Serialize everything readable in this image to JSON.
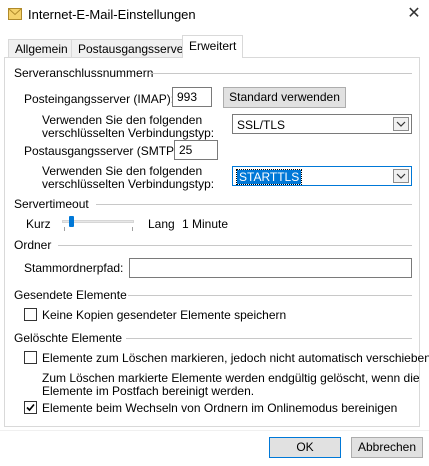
{
  "window": {
    "title": "Internet-E-Mail-Einstellungen",
    "close_glyph": "✕"
  },
  "tabs": [
    {
      "label": "Allgemein",
      "active": false
    },
    {
      "label": "Postausgangsserver",
      "active": false
    },
    {
      "label": "Erweitert",
      "active": true
    }
  ],
  "server_ports": {
    "heading": "Serveranschlussnummern",
    "incoming_label": "Posteingangsserver (IMAP):",
    "incoming_value": "993",
    "default_button": "Standard verwenden",
    "enc_in_label_1": "Verwenden Sie den folgenden",
    "enc_in_label_2": "verschlüsselten Verbindungstyp:",
    "enc_in_value": "SSL/TLS",
    "outgoing_label": "Postausgangsserver (SMTP):",
    "outgoing_value": "25",
    "enc_out_label_1": "Verwenden Sie den folgenden",
    "enc_out_label_2": "verschlüsselten Verbindungstyp:",
    "enc_out_value": "STARTTLS"
  },
  "timeout": {
    "heading": "Servertimeout",
    "short_label": "Kurz",
    "long_label": "Lang",
    "value_text": "1 Minute",
    "slider_level": 0.1
  },
  "folders": {
    "heading": "Ordner",
    "root_label": "Stammordnerpfad:",
    "root_value": ""
  },
  "sent": {
    "heading": "Gesendete Elemente",
    "no_copies_label": "Keine Kopien gesendeter Elemente speichern",
    "no_copies_checked": false
  },
  "deleted": {
    "heading": "Gelöschte Elemente",
    "mark_label": "Elemente zum Löschen markieren, jedoch nicht automatisch verschieben",
    "mark_checked": false,
    "note_line_1": "Zum Löschen markierte Elemente werden endgültig gelöscht, wenn die",
    "note_line_2": "Elemente im Postfach bereinigt werden.",
    "purge_label": "Elemente beim Wechseln von Ordnern im Onlinemodus bereinigen",
    "purge_checked": true
  },
  "footer": {
    "ok": "OK",
    "cancel": "Abbrechen"
  },
  "colors": {
    "accent": "#0078d7",
    "checkmark": "#000000"
  }
}
